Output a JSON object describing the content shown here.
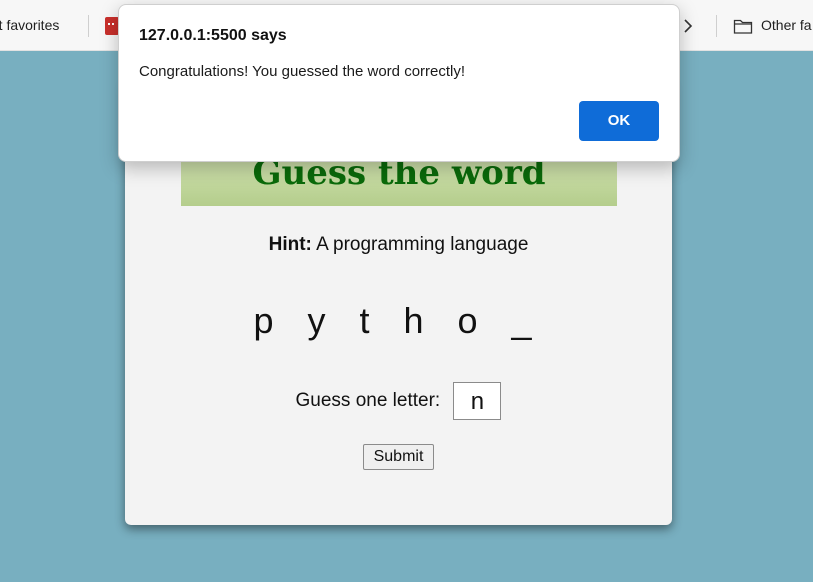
{
  "favorites_bar": {
    "import_label": "rt favorites",
    "other_label": "Other fa"
  },
  "icons": {
    "chevron": "chevron-right-icon",
    "folder": "folder-icon",
    "site": "favicon-icon"
  },
  "game": {
    "title": "Guess the word",
    "hint_label": "Hint:",
    "hint_text": "A programming language",
    "word_display": "p y t h o _",
    "guess_label": "Guess one letter:",
    "guess_value": "n",
    "submit_label": "Submit"
  },
  "dialog": {
    "title": "127.0.0.1:5500 says",
    "message": "Congratulations! You guessed the word correctly!",
    "ok_label": "OK"
  },
  "colors": {
    "page_background": "#78afc0",
    "title_color": "#0a6a0a",
    "ok_button": "#0f6cd8"
  }
}
